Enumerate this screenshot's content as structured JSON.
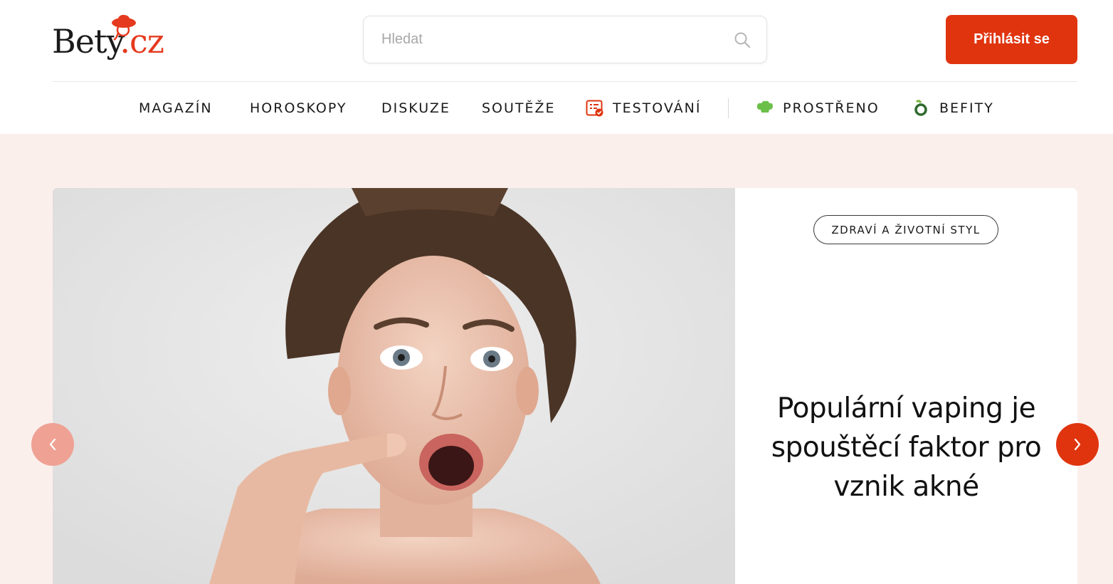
{
  "brand": {
    "logo_text": "Bety",
    "logo_tld": ".cz",
    "accent_color": "#e0340f",
    "hero_background": "#fbefec"
  },
  "search": {
    "placeholder": "Hledat",
    "icon": "search-icon"
  },
  "header": {
    "login_label": "Přihlásit se"
  },
  "nav": {
    "items": [
      {
        "label": "MAGAZÍN",
        "icon": null
      },
      {
        "label": "HOROSKOPY",
        "icon": null
      },
      {
        "label": "DISKUZE",
        "icon": null
      },
      {
        "label": "SOUTĚŽE",
        "icon": null
      },
      {
        "label": "TESTOVÁNÍ",
        "icon": "checklist-icon"
      },
      {
        "label": "PROSTŘENO",
        "icon": "chef-hat-icon"
      },
      {
        "label": "BEFITY",
        "icon": "befity-logo-icon"
      }
    ]
  },
  "hero": {
    "image": "woman-pointing-at-acne-photo",
    "category": "ZDRAVÍ A ŽIVOTNÍ STYL",
    "headline": "Populární vaping je spouštěcí faktor pro vznik akné",
    "prev_icon": "chevron-left-icon",
    "next_icon": "chevron-right-icon"
  }
}
